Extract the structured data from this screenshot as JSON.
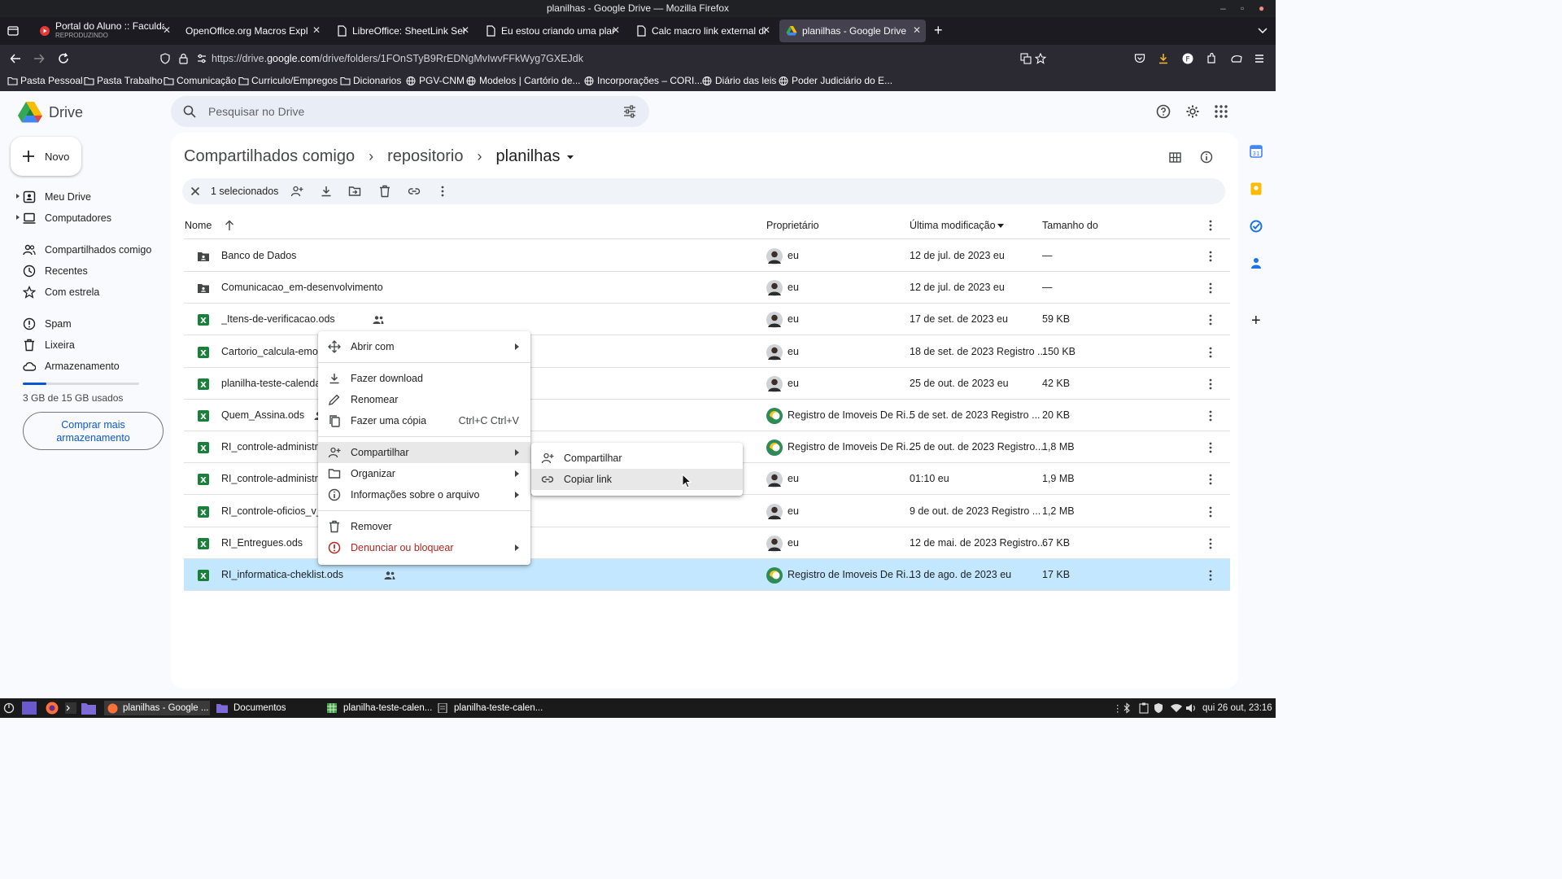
{
  "window": {
    "title": "planilhas - Google Drive — Mozilla Firefox"
  },
  "tabs": [
    {
      "title": "Portal do Aluno :: Faculdade",
      "subtitle": "REPRODUZINDO",
      "icon": "play-icon",
      "active": false
    },
    {
      "title": "OpenOffice.org Macros Explained",
      "icon": "",
      "active": false
    },
    {
      "title": "LibreOffice: SheetLink Service",
      "icon": "page-icon",
      "active": false
    },
    {
      "title": "Eu estou criando uma planilha",
      "icon": "page-icon",
      "active": false
    },
    {
      "title": "Calc macro link external data",
      "icon": "page-icon",
      "active": false
    },
    {
      "title": "planilhas - Google Drive",
      "icon": "drive-icon",
      "active": true
    }
  ],
  "url": {
    "prefix": "https://drive.",
    "domain": "google.com",
    "path": "/drive/folders/1FOnSTyB9RrEDNgMvIwvFFkWyg7GXEJdk"
  },
  "bookmarks": [
    {
      "label": "Pasta Pessoal",
      "icon": "folder-icon"
    },
    {
      "label": "Pasta Trabalho",
      "icon": "folder-icon"
    },
    {
      "label": "Comunicação",
      "icon": "folder-icon"
    },
    {
      "label": "Curriculo/Empregos",
      "icon": "folder-icon"
    },
    {
      "label": "Dicionarios",
      "icon": "folder-icon"
    },
    {
      "label": "PGV-CNM",
      "icon": "globe-icon"
    },
    {
      "label": "Modelos | Cartório de...",
      "icon": "globe-icon"
    },
    {
      "label": "Incorporações – CORI...",
      "icon": "globe-icon"
    },
    {
      "label": "Diário das leis",
      "icon": "globe-icon"
    },
    {
      "label": "Poder Judiciário do E...",
      "icon": "globe-icon"
    }
  ],
  "drive": {
    "logo_text": "Drive",
    "search_placeholder": "Pesquisar no Drive",
    "new_label": "Novo",
    "nav": [
      {
        "label": "Meu Drive",
        "icon": "my-drive-icon"
      },
      {
        "label": "Computadores",
        "icon": "computer-icon"
      },
      {
        "label": "Compartilhados comigo",
        "icon": "people-icon"
      },
      {
        "label": "Recentes",
        "icon": "clock-icon"
      },
      {
        "label": "Com estrela",
        "icon": "star-icon"
      },
      {
        "label": "Spam",
        "icon": "spam-icon"
      },
      {
        "label": "Lixeira",
        "icon": "trash-icon"
      },
      {
        "label": "Armazenamento",
        "icon": "cloud-icon"
      }
    ],
    "storage": {
      "text": "3 GB de 15 GB usados",
      "fraction": 0.2
    },
    "buy_label_1": "Comprar mais",
    "buy_label_2": "armazenamento",
    "breadcrumb": [
      "Compartilhados comigo",
      "repositorio",
      "planilhas"
    ],
    "selection_text": "1 selecionados",
    "columns": {
      "name": "Nome",
      "owner": "Proprietário",
      "modified": "Última modificação",
      "size": "Tamanho do"
    },
    "rows": [
      {
        "name": "Banco de Dados",
        "type": "shared-folder",
        "shared": false,
        "owner": "eu",
        "owner_avatar": "person",
        "modified": "12 de jul. de 2023 eu",
        "size": "—"
      },
      {
        "name": "Comunicacao_em-desenvolvimento",
        "type": "shared-folder",
        "shared": false,
        "owner": "eu",
        "owner_avatar": "person",
        "modified": "12 de jul. de 2023 eu",
        "size": "—"
      },
      {
        "name": "_Itens-de-verificacao.ods",
        "type": "sheet",
        "shared": true,
        "owner": "eu",
        "owner_avatar": "person",
        "modified": "17 de set. de 2023 eu",
        "size": "59 KB"
      },
      {
        "name": "Cartorio_calcula-emol",
        "type": "sheet",
        "shared": false,
        "owner": "eu",
        "owner_avatar": "person",
        "modified": "18 de set. de 2023 Registro ...",
        "size": "150 KB"
      },
      {
        "name": "planilha-teste-calenda",
        "type": "sheet",
        "shared": false,
        "owner": "eu",
        "owner_avatar": "person",
        "modified": "25 de out. de 2023 eu",
        "size": "42 KB"
      },
      {
        "name": "Quem_Assina.ods",
        "type": "sheet",
        "shared": true,
        "owner": "Registro de Imoveis De Ri...",
        "owner_avatar": "brand",
        "modified": "5 de set. de 2023 Registro ...",
        "size": "20 KB"
      },
      {
        "name": "RI_controle-administra",
        "type": "sheet",
        "shared": false,
        "owner": "Registro de Imoveis De Ri...",
        "owner_avatar": "brand",
        "modified": "25 de out. de 2023 Registro...",
        "size": "1,8 MB"
      },
      {
        "name": "RI_controle-administra",
        "type": "sheet",
        "shared": false,
        "owner": "eu",
        "owner_avatar": "person",
        "modified": "01:10 eu",
        "size": "1,9 MB"
      },
      {
        "name": "RI_controle-oficios_v_",
        "type": "sheet",
        "shared": false,
        "owner": "eu",
        "owner_avatar": "person",
        "modified": "9 de out. de 2023 Registro ...",
        "size": "1,2 MB"
      },
      {
        "name": "RI_Entregues.ods",
        "type": "sheet",
        "shared": true,
        "owner": "eu",
        "owner_avatar": "person",
        "modified": "12 de mai. de 2023 Registro...",
        "size": "67 KB"
      },
      {
        "name": "RI_informatica-cheklist.ods",
        "type": "sheet",
        "shared": true,
        "owner": "Registro de Imoveis De Ri...",
        "owner_avatar": "brand",
        "modified": "13 de ago. de 2023 eu",
        "size": "17 KB",
        "selected": true
      }
    ],
    "context_menu": [
      {
        "label": "Abrir com",
        "icon": "move-icon",
        "submenu": true
      },
      {
        "label": "Fazer download",
        "icon": "download-icon"
      },
      {
        "label": "Renomear",
        "icon": "pencil-icon"
      },
      {
        "label": "Fazer uma cópia",
        "icon": "copy-icon",
        "shortcut": "Ctrl+C Ctrl+V"
      },
      {
        "label": "Compartilhar",
        "icon": "person-add-icon",
        "submenu": true,
        "highlighted": true
      },
      {
        "label": "Organizar",
        "icon": "folder-icon",
        "submenu": true
      },
      {
        "label": "Informações sobre o arquivo",
        "icon": "info-icon",
        "submenu": true
      },
      {
        "label": "Remover",
        "icon": "trash-icon"
      },
      {
        "label": "Denunciar ou bloquear",
        "icon": "report-icon",
        "submenu": true,
        "danger": true
      }
    ],
    "submenu": [
      {
        "label": "Compartilhar",
        "icon": "person-add-icon"
      },
      {
        "label": "Copiar link",
        "icon": "link-icon",
        "highlighted": true
      }
    ]
  },
  "taskbar": {
    "items": [
      "planilhas - Google ...",
      "Documentos",
      "planilha-teste-calen...",
      "planilha-teste-calen..."
    ],
    "clock": "qui 26 out, 23:16"
  },
  "colors": {
    "accent": "#0b57d0",
    "selected_row": "#c2e7ff",
    "danger": "#b3261e",
    "sheet_green": "#188038"
  }
}
